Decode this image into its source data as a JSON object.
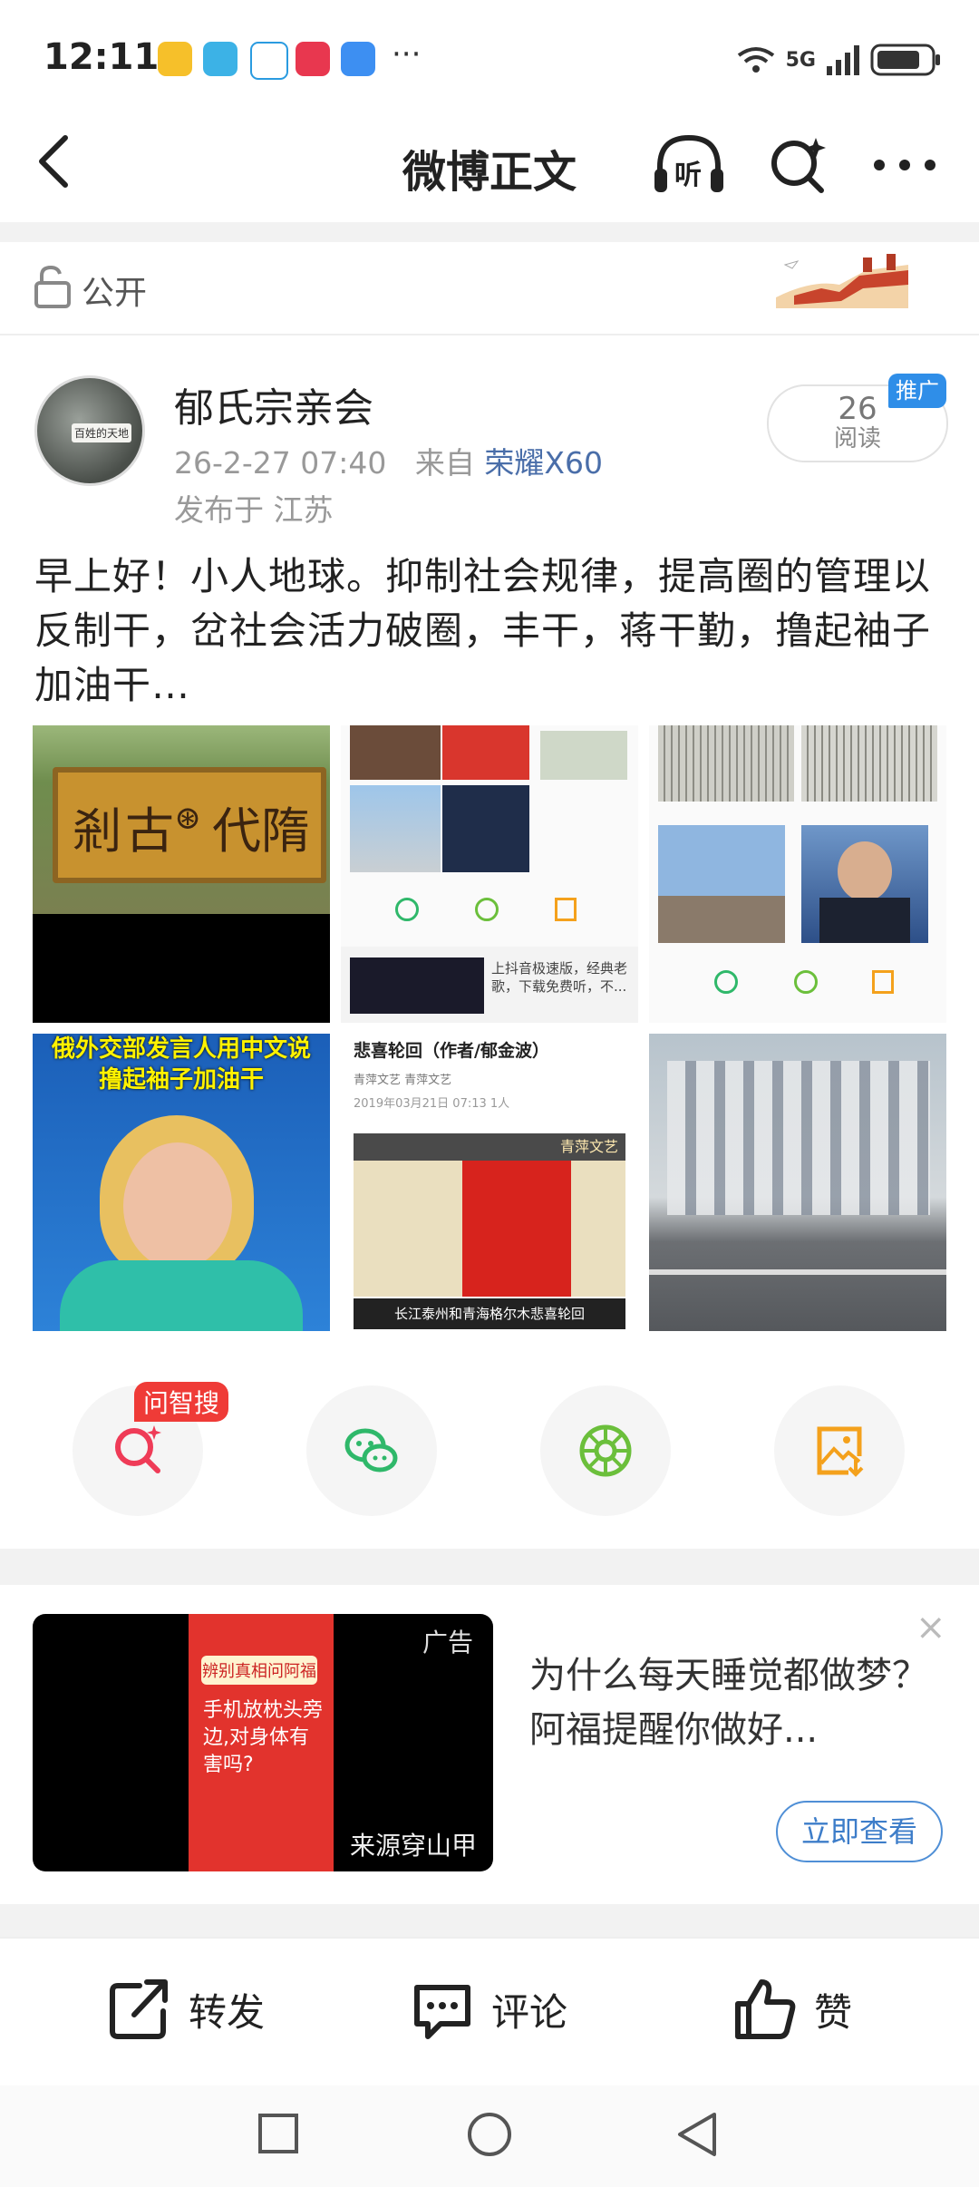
{
  "status_bar": {
    "time": "12:11",
    "more": "···",
    "network": "5G"
  },
  "header": {
    "title": "微博正文",
    "listen_label": "听"
  },
  "visibility": {
    "label": "公开"
  },
  "post": {
    "author": "郁氏宗亲会",
    "avatar_text": "百姓的天地",
    "timestamp": "26-2-27 07:40",
    "source_prefix": "来自",
    "device": "荣耀X60",
    "location": "发布于 江苏",
    "read_count": "26",
    "read_label": "阅读",
    "promo_badge": "推广",
    "text": "早上好！小人地球。抑制社会规律，提高圈的管理以反制干，岔社会活力破圈，丰干，蒋干勤，撸起袖子加油干…"
  },
  "images": {
    "img1_sign_chars": [
      "剎",
      "古",
      "⊛",
      "代",
      "隋"
    ],
    "img4_caption_1": "俄外交部发言人用中文说",
    "img4_caption_2": "撸起袖子加油干",
    "img5_title": "悲喜轮回（作者/郁金波）",
    "img5_meta": "青萍文艺  青萍文艺",
    "img5_date": "2019年03月21日 07:13   1人",
    "img5_banner": "青萍文艺",
    "img5_bottom": "长江泰州和青海格尔木悲喜轮回",
    "img2_ad": "上抖音极速版，经典老歌，下载免费听，不..."
  },
  "actions": {
    "wenzhisou_badge": "问智搜"
  },
  "ad": {
    "tag": "广告",
    "source": "来源穿山甲",
    "text": "为什么每天睡觉都做梦？阿福提醒你做好...",
    "button": "立即查看",
    "close": "×",
    "poster_title": "辨别真相问阿福",
    "poster_body": "手机放枕头旁边,对身体有害吗?"
  },
  "toolbar": {
    "repost": "转发",
    "comment": "评论",
    "like": "赞"
  },
  "colors": {
    "accent_blue": "#4a6ea9",
    "promo_blue": "#2f8ee8",
    "badge_red": "#ef3b37",
    "wechat_green": "#2fb86a",
    "moments_green": "#6bbf3b",
    "save_orange": "#f4a11c"
  }
}
